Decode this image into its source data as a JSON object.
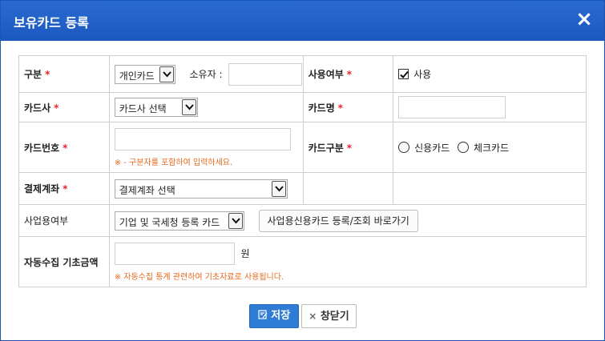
{
  "dialog": {
    "title": "보유카드 등록",
    "close_icon": "×"
  },
  "form": {
    "category": {
      "label": "구분",
      "required_mark": "*",
      "value": "개인카드",
      "owner_label": "소유자 :"
    },
    "usage": {
      "label": "사용여부",
      "required_mark": "*",
      "checkbox_label": "사용",
      "checked": true
    },
    "card_company": {
      "label": "카드사",
      "required_mark": "*",
      "value": "카드사 선택"
    },
    "card_name": {
      "label": "카드명",
      "required_mark": "*"
    },
    "card_number": {
      "label": "카드번호",
      "required_mark": "*",
      "hint": "※ - 구분자를 포함하여 입력하세요."
    },
    "card_type": {
      "label": "카드구분",
      "required_mark": "*",
      "option_credit": "신용카드",
      "option_check": "체크카드"
    },
    "payment_account": {
      "label": "결제계좌",
      "required_mark": "*",
      "value": "결제계좌 선택"
    },
    "business_use": {
      "label": "사업용여부",
      "value": "기업 및 국세청 등록 카드",
      "link_button": "사업용신용카드 등록/조회 바로가기"
    },
    "auto_amount": {
      "label": "자동수집 기초금액",
      "unit": "원",
      "hint": "※ 자동수집 통계 관련하여 기초자료로 사용됩니다."
    }
  },
  "footer": {
    "save_label": "저장",
    "close_label": "창닫기",
    "close_icon": "×"
  },
  "colors": {
    "titlebar": "#1b58c0",
    "required": "#e8232b",
    "hint": "#e86a1c",
    "save_button": "#2f7cd6"
  }
}
